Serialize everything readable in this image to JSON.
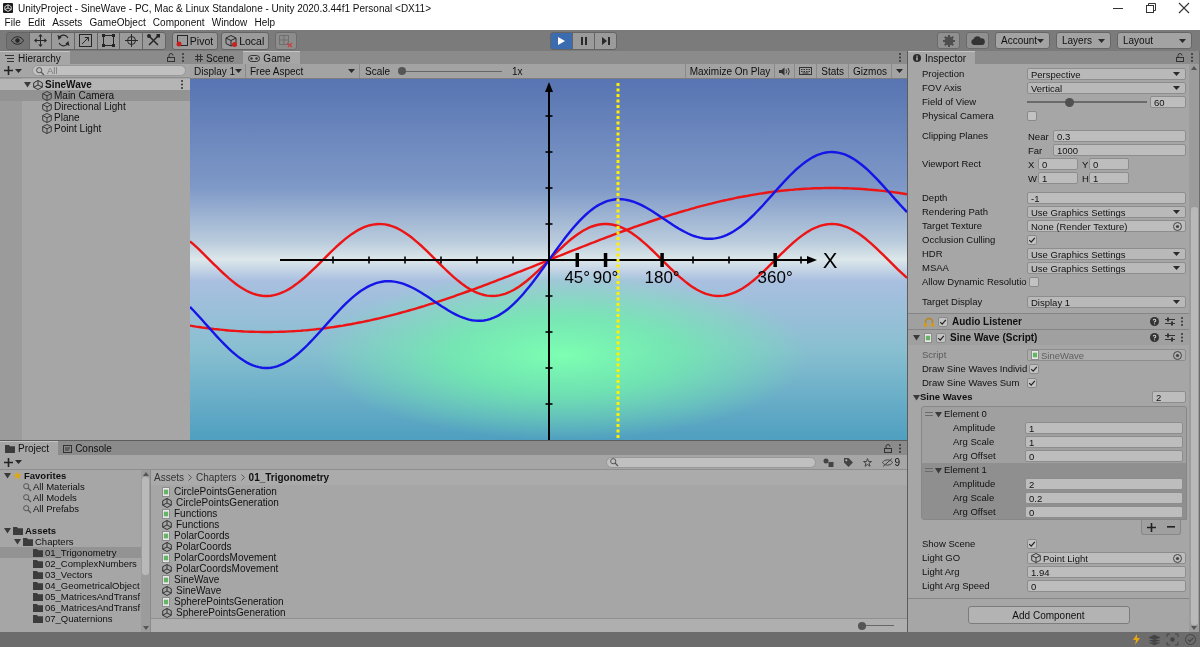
{
  "window": {
    "title": "UnityProject - SineWave - PC, Mac & Linux Standalone - Unity 2020.3.44f1 Personal <DX11>"
  },
  "menu": [
    "File",
    "Edit",
    "Assets",
    "GameObject",
    "Component",
    "Window",
    "Help"
  ],
  "toolbar": {
    "tools": [
      {
        "kind": "view",
        "selected": true
      },
      {
        "kind": "move",
        "selected": false
      },
      {
        "kind": "rotate",
        "selected": false
      },
      {
        "kind": "scale",
        "selected": false
      },
      {
        "kind": "rect",
        "selected": false
      },
      {
        "kind": "transform",
        "selected": false
      },
      {
        "kind": "custom",
        "selected": false
      }
    ],
    "pivot": "Pivot",
    "space": "Local",
    "playback": [
      {
        "kind": "play",
        "on": true
      },
      {
        "kind": "pause",
        "on": false
      },
      {
        "kind": "step",
        "on": false
      }
    ],
    "account": "Account",
    "layers": "Layers",
    "layout": "Layout"
  },
  "hierarchy": {
    "tab": "Hierarchy",
    "search": {
      "placeholder": "All"
    },
    "items": [
      {
        "label": "SineWave",
        "kind": "scene",
        "expanded": true,
        "selected": false,
        "children": [
          {
            "label": "Main Camera",
            "kind": "object",
            "selected": true
          },
          {
            "label": "Directional Light",
            "kind": "object",
            "selected": false
          },
          {
            "label": "Plane",
            "kind": "object",
            "selected": false
          },
          {
            "label": "Point Light",
            "kind": "object",
            "selected": false
          }
        ]
      }
    ]
  },
  "game": {
    "tabs": [
      {
        "label": "Scene",
        "kind": "scene",
        "selected": false
      },
      {
        "label": "Game",
        "kind": "game",
        "selected": true
      }
    ],
    "display": "Display 1",
    "aspect": "Free Aspect",
    "scale_label": "Scale",
    "scale": {
      "level": 0
    },
    "scale_value": "1x",
    "maximize": "Maximize On Play",
    "stats": "Stats",
    "gizmos": "Gizmos",
    "axis_title": "X",
    "angle_labels": [
      "45°",
      "90°",
      "180°",
      "360°"
    ]
  },
  "inspector": {
    "tab": "Inspector",
    "camera": [
      [
        {
          "kind": "dropdown",
          "label": "Projection",
          "value": "Perspective"
        },
        {
          "kind": "dropdown",
          "label": "FOV Axis",
          "value": "Vertical"
        },
        {
          "kind": "slider",
          "label": "Field of View",
          "level": 0.34,
          "value": "60"
        },
        {
          "kind": "checkbox",
          "label": "Physical Camera",
          "checked": false
        }
      ],
      [
        {
          "kind": "pair",
          "label": "Clipping Planes",
          "fields": [
            {
              "label": "Near",
              "value": "0.3"
            },
            {
              "label": "Far",
              "value": "1000"
            }
          ]
        },
        {
          "kind": "rect",
          "label": "Viewport Rect",
          "fields": [
            {
              "label": "X",
              "value": "0"
            },
            {
              "label": "Y",
              "value": "0"
            },
            {
              "label": "W",
              "value": "1"
            },
            {
              "label": "H",
              "value": "1"
            }
          ]
        }
      ],
      [
        {
          "kind": "text",
          "label": "Depth",
          "value": "-1"
        },
        {
          "kind": "dropdown",
          "label": "Rendering Path",
          "value": "Use Graphics Settings"
        },
        {
          "kind": "object",
          "label": "Target Texture",
          "value": "None (Render Texture)"
        },
        {
          "kind": "checkbox",
          "label": "Occlusion Culling",
          "checked": true
        },
        {
          "kind": "dropdown",
          "label": "HDR",
          "value": "Use Graphics Settings"
        },
        {
          "kind": "dropdown",
          "label": "MSAA",
          "value": "Use Graphics Settings"
        },
        {
          "kind": "checkbox",
          "label": "Allow Dynamic Resolutio",
          "checked": false
        }
      ],
      [
        {
          "kind": "dropdown",
          "label": "Target Display",
          "value": "Display 1"
        }
      ]
    ],
    "audio_listener": {
      "title": "Audio Listener",
      "enabled": true
    },
    "sine_wave": {
      "title": "Sine Wave (Script)",
      "enabled": true,
      "expanded": true,
      "script": {
        "label": "Script",
        "value": "SineWave",
        "disabled": true
      },
      "toggles": [
        {
          "label": "Draw Sine Waves Individ",
          "checked": true
        },
        {
          "label": "Draw Sine Waves Sum",
          "checked": true
        }
      ],
      "list": {
        "label": "Sine Waves",
        "expanded": true,
        "count": "2",
        "elements": [
          {
            "label": "Element 0",
            "expanded": true,
            "selected": false,
            "fields": [
              {
                "label": "Amplitude",
                "value": "1"
              },
              {
                "label": "Arg Scale",
                "value": "1"
              },
              {
                "label": "Arg Offset",
                "value": "0"
              }
            ]
          },
          {
            "label": "Element 1",
            "expanded": true,
            "selected": true,
            "fields": [
              {
                "label": "Amplitude",
                "value": "2"
              },
              {
                "label": "Arg Scale",
                "value": "0.2"
              },
              {
                "label": "Arg Offset",
                "value": "0"
              }
            ]
          }
        ]
      },
      "fields": [
        {
          "kind": "checkbox",
          "label": "Show Scene",
          "checked": true
        },
        {
          "kind": "gameobject",
          "label": "Light GO",
          "value": "Point Light"
        },
        {
          "kind": "text",
          "label": "Light Arg",
          "value": "1.94"
        },
        {
          "kind": "text",
          "label": "Light Arg Speed",
          "value": "0"
        }
      ]
    },
    "add_component": "Add Component"
  },
  "project": {
    "tabs": [
      {
        "label": "Project",
        "kind": "project",
        "selected": true
      },
      {
        "label": "Console",
        "kind": "console",
        "selected": false
      }
    ],
    "hidden_count": "9",
    "tree": [
      {
        "label": "Favorites",
        "kind": "favorites",
        "expanded": true,
        "selected": false,
        "children": [
          {
            "label": "All Materials",
            "kind": "search",
            "selected": false
          },
          {
            "label": "All Models",
            "kind": "search",
            "selected": false
          },
          {
            "label": "All Prefabs",
            "kind": "search",
            "selected": false
          }
        ]
      },
      {
        "label": "Assets",
        "kind": "folder",
        "expanded": true,
        "selected": false,
        "children": [
          {
            "label": "Chapters",
            "kind": "folder",
            "expanded": true,
            "selected": false,
            "children": [
              {
                "label": "01_Trigonometry",
                "kind": "folder",
                "selected": true
              },
              {
                "label": "02_ComplexNumbers",
                "kind": "folder",
                "selected": false
              },
              {
                "label": "03_Vectors",
                "kind": "folder",
                "selected": false
              },
              {
                "label": "04_GeometricalObject",
                "kind": "folder",
                "selected": false
              },
              {
                "label": "05_MatricesAndTransf",
                "kind": "folder",
                "selected": false
              },
              {
                "label": "06_MatricesAndTransf",
                "kind": "folder",
                "selected": false
              },
              {
                "label": "07_Quaternions",
                "kind": "folder",
                "selected": false
              }
            ]
          }
        ]
      }
    ],
    "breadcrumb": [
      "Assets",
      "Chapters",
      "01_Trigonometry"
    ],
    "files": [
      {
        "kind": "script",
        "name": "CirclePointsGeneration",
        "selected": false
      },
      {
        "kind": "scene",
        "name": "CirclePointsGeneration",
        "selected": false
      },
      {
        "kind": "script",
        "name": "Functions",
        "selected": false
      },
      {
        "kind": "scene",
        "name": "Functions",
        "selected": false
      },
      {
        "kind": "script",
        "name": "PolarCoords",
        "selected": false
      },
      {
        "kind": "scene",
        "name": "PolarCoords",
        "selected": false
      },
      {
        "kind": "script",
        "name": "PolarCoordsMovement",
        "selected": false
      },
      {
        "kind": "scene",
        "name": "PolarCoordsMovement",
        "selected": false
      },
      {
        "kind": "script",
        "name": "SineWave",
        "selected": false
      },
      {
        "kind": "scene",
        "name": "SineWave",
        "selected": false
      },
      {
        "kind": "script",
        "name": "SpherePointsGeneration",
        "selected": false
      },
      {
        "kind": "scene",
        "name": "SpherePointsGeneration",
        "selected": false
      }
    ],
    "zoom": {
      "level": 0
    }
  }
}
